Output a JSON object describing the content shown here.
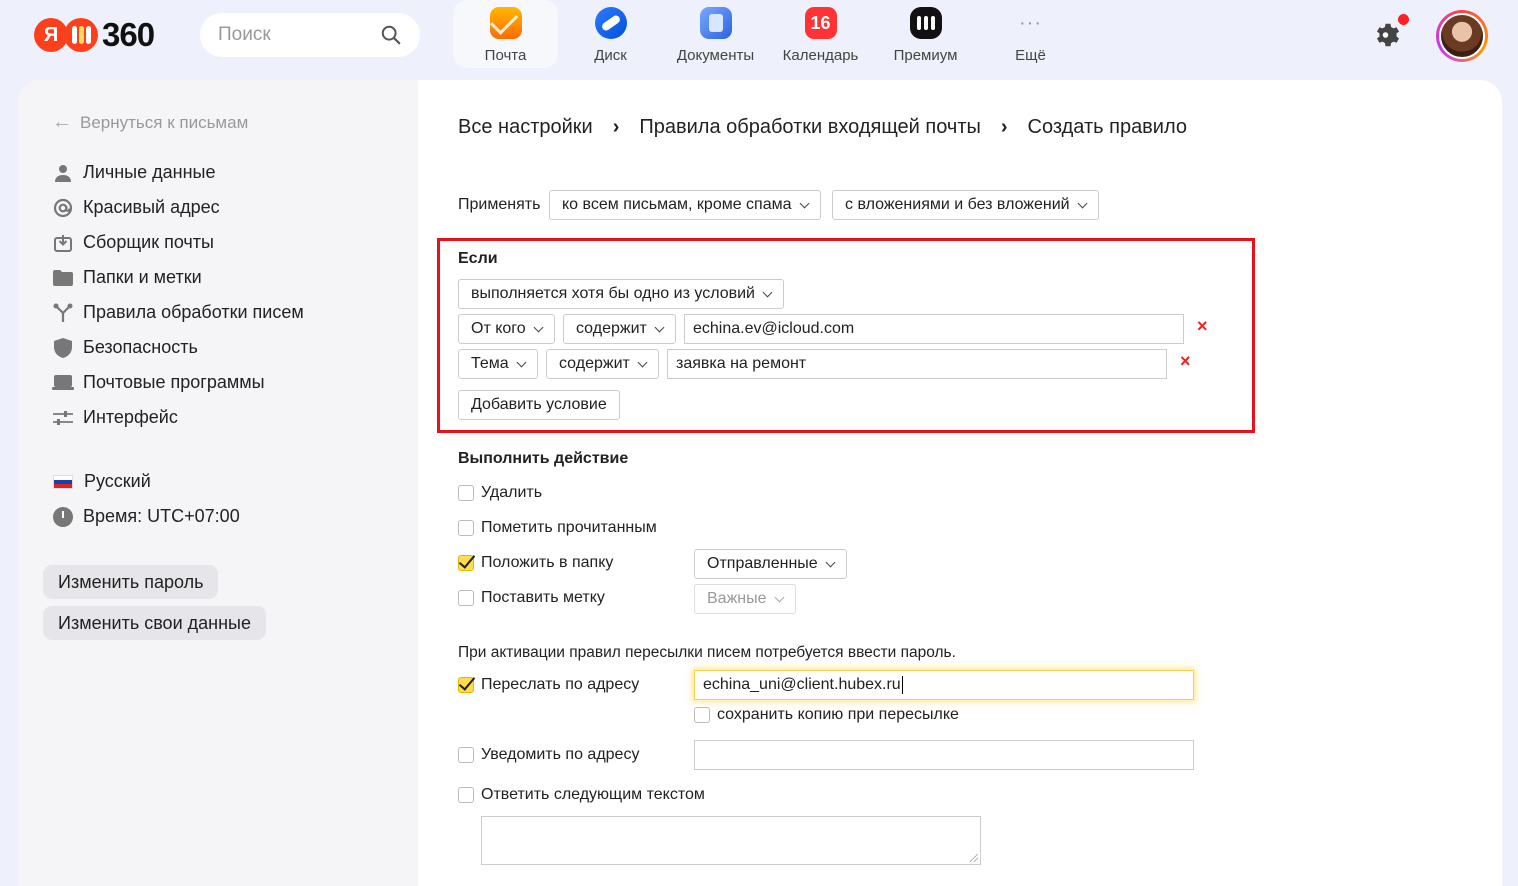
{
  "header": {
    "logo_ya": "Я",
    "logo_num": "360",
    "search_placeholder": "Поиск",
    "apps": [
      {
        "label": "Почта",
        "icon": "mail-icon"
      },
      {
        "label": "Диск",
        "icon": "disk-icon"
      },
      {
        "label": "Документы",
        "icon": "documents-icon"
      },
      {
        "label": "Календарь",
        "icon": "calendar-icon",
        "badge": "16"
      },
      {
        "label": "Премиум",
        "icon": "premium-icon"
      },
      {
        "label": "Ещё",
        "icon": "more-icon",
        "glyph": "···"
      }
    ],
    "accent": "#fc3f1d"
  },
  "sidebar": {
    "back": "Вернуться к письмам",
    "items": [
      {
        "label": "Личные данные",
        "icon": "person-icon"
      },
      {
        "label": "Красивый адрес",
        "icon": "at-sign-icon"
      },
      {
        "label": "Сборщик почты",
        "icon": "collector-icon"
      },
      {
        "label": "Папки и метки",
        "icon": "folder-icon"
      },
      {
        "label": "Правила обработки писем",
        "icon": "rules-icon"
      },
      {
        "label": "Безопасность",
        "icon": "shield-icon"
      },
      {
        "label": "Почтовые программы",
        "icon": "laptop-icon"
      },
      {
        "label": "Интерфейс",
        "icon": "sliders-icon"
      }
    ],
    "language": "Русский",
    "time": "Время: UTC+07:00",
    "change_password": "Изменить пароль",
    "change_data": "Изменить свои данные"
  },
  "breadcrumbs": [
    "Все настройки",
    "Правила обработки входящей почты",
    "Создать правило"
  ],
  "apply": {
    "label": "Применять",
    "scope": "ко всем письмам, кроме спама",
    "attachments": "с вложениями и без вложений"
  },
  "conditions": {
    "title": "Если",
    "mode": "выполняется хотя бы одно из условий",
    "rows": [
      {
        "field": "От кого",
        "op": "содержит",
        "value": "echina.ev@icloud.com",
        "remove": "×"
      },
      {
        "field": "Тема",
        "op": "содержит",
        "value": "заявка на ремонт",
        "remove": "×"
      }
    ],
    "add_button": "Добавить условие"
  },
  "actions": {
    "title": "Выполнить действие",
    "delete": {
      "label": "Удалить",
      "checked": false
    },
    "mark_read": {
      "label": "Пометить прочитанным",
      "checked": false
    },
    "move": {
      "label": "Положить в папку",
      "checked": true,
      "folder": "Отправленные"
    },
    "tag": {
      "label": "Поставить метку",
      "checked": false,
      "value": "Важные"
    },
    "forward_note": "При активации правил пересылки писем потребуется ввести пароль.",
    "forward": {
      "label": "Переслать по адресу",
      "checked": true,
      "value": "echina_uni@client.hubex.ru"
    },
    "keep_copy": {
      "label": "сохранить копию при пересылке",
      "checked": false
    },
    "notify": {
      "label": "Уведомить по адресу",
      "checked": false,
      "value": ""
    },
    "reply": {
      "label": "Ответить следующим текстом",
      "checked": false
    }
  }
}
